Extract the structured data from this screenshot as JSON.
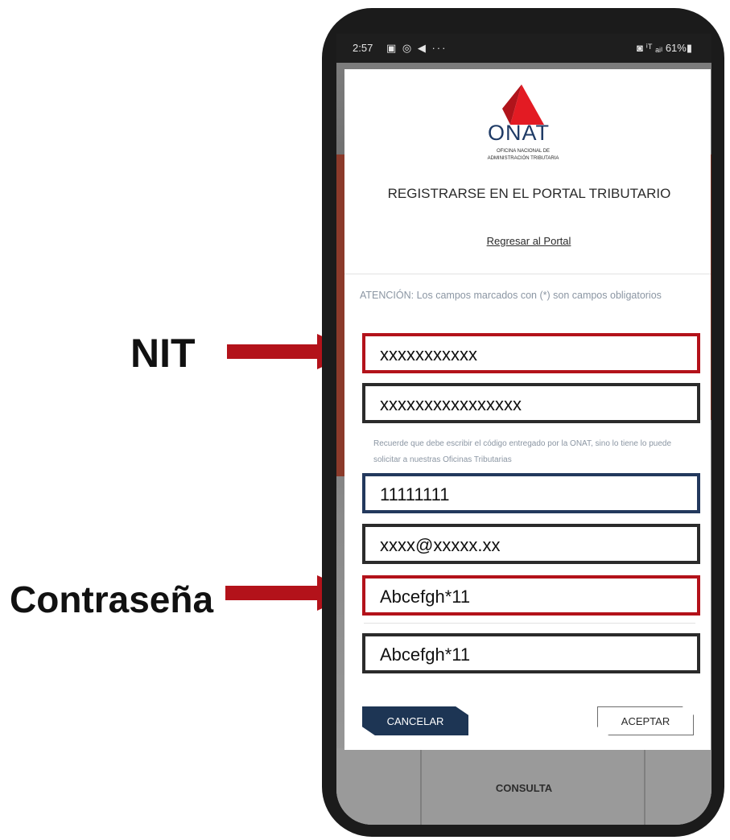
{
  "annotations": {
    "nit_label": "NIT",
    "password_label": "Contraseña",
    "arrow_color": "#b3121a"
  },
  "status_bar": {
    "time": "2:57",
    "left_icons": "▣ ◎ ◀ ···",
    "right": "◙ ⁱᵀ ₐᵢₗ 61%▮"
  },
  "brand": {
    "logo_text": "ONAT",
    "subtitle_line1": "OFICINA NACIONAL DE",
    "subtitle_line2": "ADMINISTRACIÓN TRIBUTARIA"
  },
  "form": {
    "title": "REGISTRARSE EN EL PORTAL TRIBUTARIO",
    "back_link": "Regresar al Portal",
    "notice": "ATENCIÓN: Los campos marcados con (*) son campos obligatorios",
    "nit_value": "xxxxxxxxxxx",
    "code_value": "xxxxxxxxxxxxxxxx",
    "hint": "Recuerde que debe escribir el código entregado por la ONAT, sino lo tiene lo puede solicitar a nuestras Oficinas Tributarias",
    "phone_value": "11111111",
    "email_value": "xxxx@xxxxx.xx",
    "password_value": "Abcefgh*11",
    "password_confirm_value": "Abcefgh*11",
    "cancel_label": "CANCELAR",
    "accept_label": "ACEPTAR"
  },
  "background": {
    "bottom_label": "CONSULTA"
  }
}
